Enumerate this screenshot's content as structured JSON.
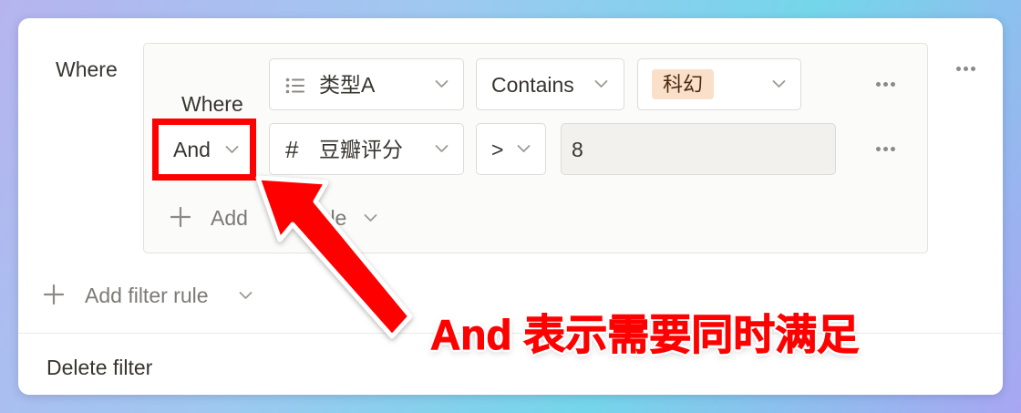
{
  "filter": {
    "outer_where": "Where",
    "rules": [
      {
        "prefix": "Where",
        "property_label": "类型A",
        "operator": "Contains",
        "value_tag": "科幻"
      },
      {
        "prefix": "And",
        "property_label": "豆瓣评分",
        "property_icon_glyph": "#",
        "operator": ">",
        "value": "8"
      }
    ],
    "add_rule_text": "Add filter rule",
    "inner_add_visible": "Add",
    "inner_add_tail": "rule",
    "delete_filter": "Delete filter"
  },
  "annotation": {
    "text": "And 表示需要同时满足",
    "color": "#ff0000"
  },
  "colors": {
    "tag_bg": "#fbe0c9",
    "highlight_box": "#ff0000",
    "value_box_bg": "#f2f1ee"
  },
  "icons": {
    "list": "list-icon",
    "number": "hash-icon",
    "chevron": "chevron-down-icon",
    "more": "more-dots-icon",
    "plus": "plus-icon"
  }
}
